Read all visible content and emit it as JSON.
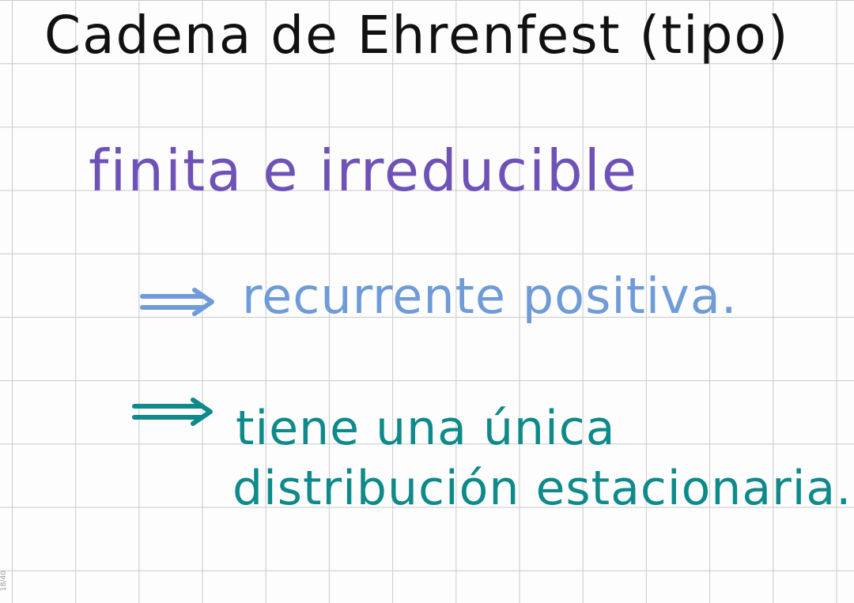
{
  "note": {
    "title": "Cadena de Ehrenfest (tipo)",
    "heading": "finita e irreducible",
    "implication_1": "recurrente positiva.",
    "implication_2_line_1": "tiene una única",
    "implication_2_line_2": "distribución estacionaria.",
    "page_number": "18/40"
  },
  "colors": {
    "title": "#111111",
    "heading": "#6f52b8",
    "implication_1": "#6f9bd8",
    "implication_2": "#0e8a8a",
    "grid": "#c9c9c9"
  },
  "icons": {
    "implication_arrow": "double-arrow-right-icon"
  }
}
